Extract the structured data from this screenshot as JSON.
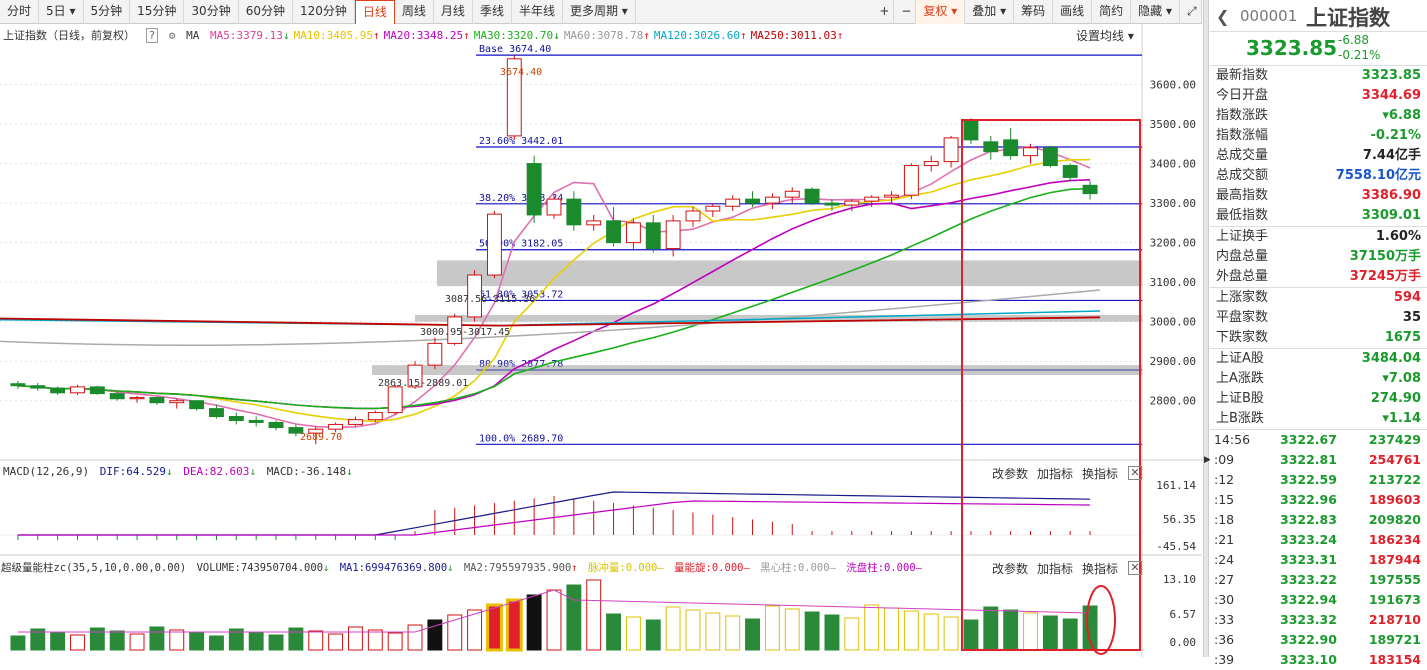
{
  "toolbar": {
    "tabs": [
      "分时",
      "5日",
      "5分钟",
      "15分钟",
      "30分钟",
      "60分钟",
      "120分钟",
      "日线",
      "周线",
      "月线",
      "季线",
      "半年线",
      "更多周期"
    ],
    "active": "日线",
    "right": [
      "+",
      "−",
      "复权",
      "叠加",
      "筹码",
      "画线",
      "简约",
      "隐藏"
    ],
    "expand_icon": "expand-icon"
  },
  "main_legend": {
    "title": "上证指数（日线，前复权）",
    "ma_label": "MA",
    "items": [
      {
        "text": "MA5:3379.13",
        "arrow": "↓",
        "color": "#d9419b"
      },
      {
        "text": "MA10:3405.95",
        "arrow": "↑",
        "color": "#e8c000"
      },
      {
        "text": "MA20:3348.25",
        "arrow": "↑",
        "color": "#c000c0"
      },
      {
        "text": "MA30:3320.70",
        "arrow": "↓",
        "color": "#1ab01a"
      },
      {
        "text": "MA60:3078.78",
        "arrow": "↑",
        "color": "#999999"
      },
      {
        "text": "MA120:3026.60",
        "arrow": "↑",
        "color": "#00a8c8"
      },
      {
        "text": "MA250:3011.03",
        "arrow": "↑",
        "color": "#c00000"
      }
    ],
    "settings": "设置均线 ▾"
  },
  "macd_legend": {
    "title": "MACD(12,26,9)",
    "dif": "DIF:64.529",
    "dif_arrow": "↓",
    "dea": "DEA:82.603",
    "dea_arrow": "↓",
    "macd": "MACD:-36.148",
    "macd_arrow": "↓",
    "buttons": [
      "改参数",
      "加指标",
      "换指标"
    ]
  },
  "vol_legend": {
    "title": "超级量能柱zc(35,5,10,0.00,0.00)",
    "volume": "VOLUME:743950704.000",
    "volume_arrow": "↓",
    "ma1": "MA1:699476369.800",
    "ma1_arrow": "↓",
    "ma2": "MA2:795597935.900",
    "ma2_arrow": "↑",
    "xcl": "脉冲量:0.000",
    "xcl_arrow": "—",
    "lnx": "量能旋:0.000",
    "lnx_arrow": "—",
    "hxz": "黑心柱:0.000",
    "hxz_arrow": "—",
    "xpz": "洗盘柱:0.000",
    "xpz_arrow": "—",
    "buttons": [
      "改参数",
      "加指标",
      "换指标"
    ]
  },
  "chart_data": {
    "type": "candlestick",
    "price_axis": {
      "min": 2650,
      "max": 3700,
      "ticks": [
        "3600.00",
        "3500.00",
        "3400.00",
        "3300.00",
        "3200.00",
        "3100.00",
        "3000.00",
        "2900.00",
        "2800.00"
      ]
    },
    "macd_axis": {
      "ticks": [
        "161.14",
        "56.35",
        "-45.54"
      ]
    },
    "vol_axis": {
      "ticks": [
        "13.10",
        "6.57",
        "0.00"
      ]
    },
    "fib_levels": [
      {
        "label": "Base",
        "value": "3674.40"
      },
      {
        "label": "23.60%",
        "value": "3442.01"
      },
      {
        "label": "38.20%",
        "value": "3298.24"
      },
      {
        "label": "50.00%",
        "value": "3182.05"
      },
      {
        "label": "61.80%",
        "value": "3053.72"
      },
      {
        "label": "80.90%",
        "value": "2877.78"
      },
      {
        "label": "100.0%",
        "value": "2689.70"
      }
    ],
    "annotations": [
      "3674.40",
      "2689.70",
      "3087.56-3115.36",
      "3000.95-3017.45",
      "2863.15-2889.01"
    ],
    "candles": [
      [
        2843,
        2850,
        2830,
        2838
      ],
      [
        2838,
        2845,
        2825,
        2832
      ],
      [
        2832,
        2836,
        2815,
        2820
      ],
      [
        2820,
        2840,
        2815,
        2835
      ],
      [
        2835,
        2838,
        2815,
        2818
      ],
      [
        2818,
        2822,
        2800,
        2805
      ],
      [
        2805,
        2812,
        2795,
        2808
      ],
      [
        2808,
        2810,
        2790,
        2795
      ],
      [
        2795,
        2805,
        2780,
        2800
      ],
      [
        2800,
        2802,
        2775,
        2780
      ],
      [
        2780,
        2790,
        2755,
        2760
      ],
      [
        2760,
        2770,
        2740,
        2750
      ],
      [
        2750,
        2760,
        2735,
        2745
      ],
      [
        2745,
        2750,
        2725,
        2732
      ],
      [
        2732,
        2740,
        2710,
        2718
      ],
      [
        2718,
        2735,
        2690,
        2728
      ],
      [
        2728,
        2745,
        2720,
        2740
      ],
      [
        2740,
        2760,
        2735,
        2752
      ],
      [
        2752,
        2775,
        2745,
        2770
      ],
      [
        2770,
        2840,
        2765,
        2835
      ],
      [
        2835,
        2900,
        2830,
        2890
      ],
      [
        2890,
        2960,
        2880,
        2945
      ],
      [
        2945,
        3020,
        2940,
        3012
      ],
      [
        3012,
        3130,
        3000,
        3118
      ],
      [
        3118,
        3280,
        3110,
        3272
      ],
      [
        3470,
        3674,
        3460,
        3665
      ],
      [
        3400,
        3420,
        3250,
        3270
      ],
      [
        3270,
        3320,
        3260,
        3310
      ],
      [
        3310,
        3330,
        3230,
        3245
      ],
      [
        3245,
        3270,
        3230,
        3255
      ],
      [
        3255,
        3290,
        3190,
        3200
      ],
      [
        3200,
        3260,
        3180,
        3250
      ],
      [
        3250,
        3270,
        3175,
        3185
      ],
      [
        3185,
        3270,
        3165,
        3255
      ],
      [
        3255,
        3290,
        3240,
        3280
      ],
      [
        3280,
        3300,
        3265,
        3292
      ],
      [
        3292,
        3320,
        3280,
        3310
      ],
      [
        3310,
        3330,
        3290,
        3300
      ],
      [
        3300,
        3325,
        3285,
        3315
      ],
      [
        3315,
        3340,
        3300,
        3330
      ],
      [
        3335,
        3340,
        3295,
        3300
      ],
      [
        3300,
        3310,
        3280,
        3295
      ],
      [
        3295,
        3310,
        3280,
        3305
      ],
      [
        3305,
        3320,
        3290,
        3315
      ],
      [
        3315,
        3330,
        3300,
        3320
      ],
      [
        3320,
        3400,
        3310,
        3395
      ],
      [
        3395,
        3420,
        3380,
        3405
      ],
      [
        3405,
        3470,
        3390,
        3465
      ],
      [
        3510,
        3515,
        3450,
        3460
      ],
      [
        3455,
        3470,
        3410,
        3430
      ],
      [
        3460,
        3490,
        3410,
        3420
      ],
      [
        3420,
        3450,
        3400,
        3440
      ],
      [
        3440,
        3445,
        3390,
        3395
      ],
      [
        3395,
        3400,
        3355,
        3365
      ],
      [
        3345,
        3356,
        3309,
        3324
      ]
    ]
  },
  "quote": {
    "code": "000001",
    "name": "上证指数",
    "price": "3323.85",
    "change": "-6.88",
    "change_pct": "-0.21%",
    "rows1": [
      {
        "k": "最新指数",
        "v": "3323.85",
        "c": "green"
      },
      {
        "k": "今日开盘",
        "v": "3344.69",
        "c": "red"
      },
      {
        "k": "指数涨跌",
        "v": "▾6.88",
        "c": "green"
      },
      {
        "k": "指数涨幅",
        "v": "-0.21%",
        "c": "green"
      },
      {
        "k": "总成交量",
        "v": "7.44亿手",
        "c": "blk"
      },
      {
        "k": "总成交额",
        "v": "7558.10亿元",
        "c": "blue"
      },
      {
        "k": "最高指数",
        "v": "3386.90",
        "c": "red"
      },
      {
        "k": "最低指数",
        "v": "3309.01",
        "c": "green"
      }
    ],
    "rows2": [
      {
        "k": "上证换手",
        "v": "1.60%",
        "c": "blk"
      },
      {
        "k": "内盘总量",
        "v": "37150万手",
        "c": "green"
      },
      {
        "k": "外盘总量",
        "v": "37245万手",
        "c": "red"
      }
    ],
    "rows3": [
      {
        "k": "上涨家数",
        "v": "594",
        "c": "red"
      },
      {
        "k": "平盘家数",
        "v": "35",
        "c": "blk"
      },
      {
        "k": "下跌家数",
        "v": "1675",
        "c": "green"
      }
    ],
    "rows4": [
      {
        "k": "上证A股",
        "v": "3484.04",
        "c": "green"
      },
      {
        "k": "上A涨跌",
        "v": "▾7.08",
        "c": "green"
      },
      {
        "k": "上证B股",
        "v": "274.90",
        "c": "green"
      },
      {
        "k": "上B涨跌",
        "v": "▾1.14",
        "c": "green"
      }
    ],
    "ticks": [
      {
        "t": "14:56",
        "p": "3322.67",
        "q": "237429",
        "qc": "green"
      },
      {
        "t": ":09",
        "p": "3322.81",
        "q": "254761",
        "qc": "red"
      },
      {
        "t": ":12",
        "p": "3322.59",
        "q": "213722",
        "qc": "green"
      },
      {
        "t": ":15",
        "p": "3322.96",
        "q": "189603",
        "qc": "red"
      },
      {
        "t": ":18",
        "p": "3322.83",
        "q": "209820",
        "qc": "green"
      },
      {
        "t": ":21",
        "p": "3323.24",
        "q": "186234",
        "qc": "red"
      },
      {
        "t": ":24",
        "p": "3323.31",
        "q": "187944",
        "qc": "red"
      },
      {
        "t": ":27",
        "p": "3323.22",
        "q": "197555",
        "qc": "green"
      },
      {
        "t": ":30",
        "p": "3322.94",
        "q": "191673",
        "qc": "green"
      },
      {
        "t": ":33",
        "p": "3323.32",
        "q": "218710",
        "qc": "red"
      },
      {
        "t": ":36",
        "p": "3322.90",
        "q": "189721",
        "qc": "green"
      },
      {
        "t": ":39",
        "p": "3323.10",
        "q": "183154",
        "qc": "red"
      }
    ]
  }
}
